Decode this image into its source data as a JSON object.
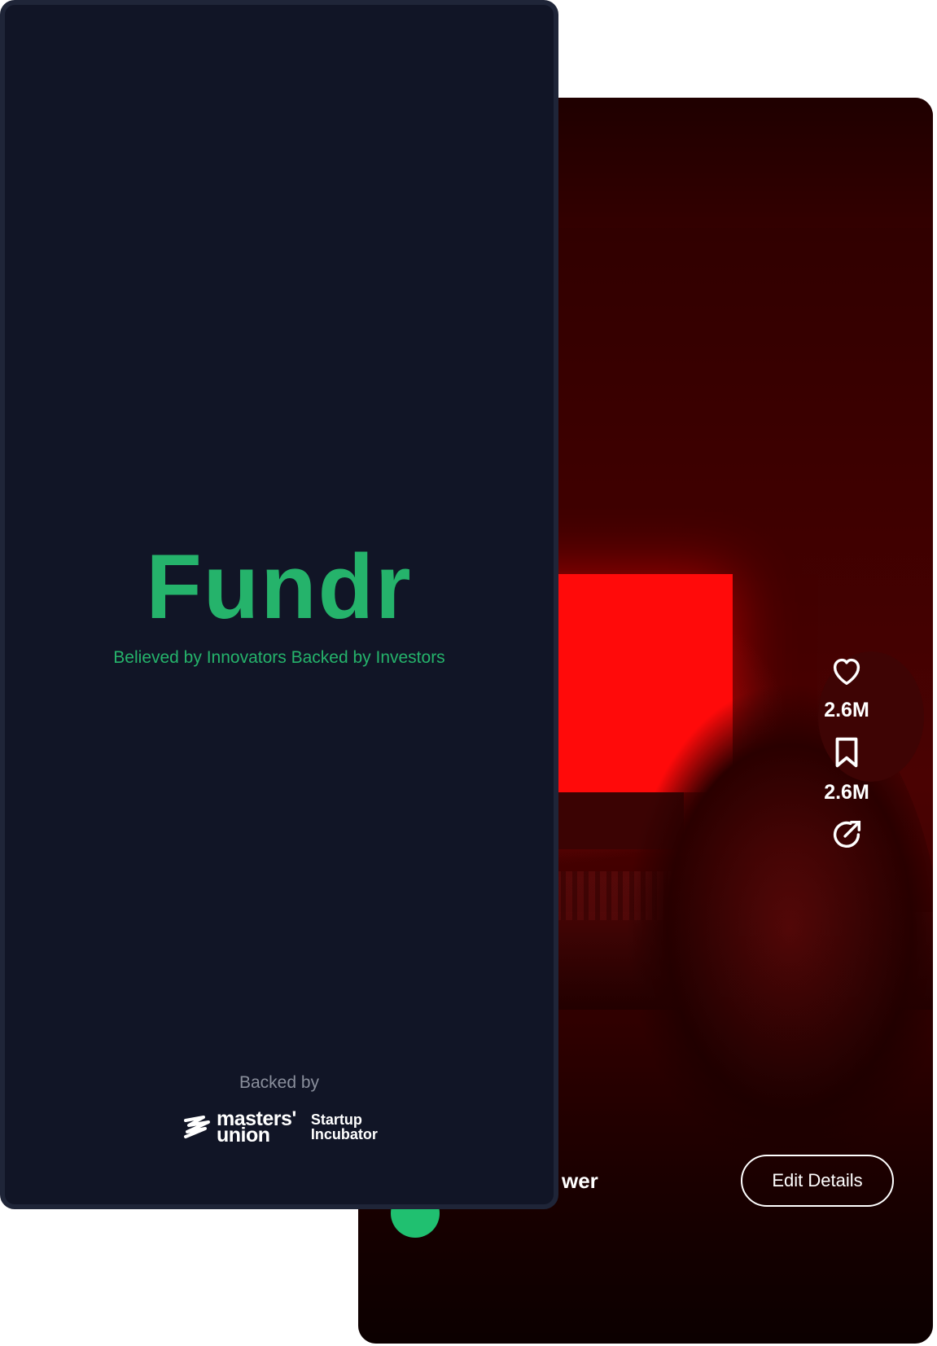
{
  "splash": {
    "brand": "Fundr",
    "tagline": "Believed by Innovators Backed by Investors",
    "backed_by": "Backed by",
    "sponsor": {
      "line1": "masters'",
      "line2": "union",
      "program1": "Startup",
      "program2": "Incubator"
    }
  },
  "feed": {
    "likes": "2.6M",
    "saves": "2.6M",
    "creator_partial": "wer",
    "edit_button": "Edit Details"
  },
  "colors": {
    "brand_green": "#25b36b",
    "splash_bg": "#111526",
    "feed_red": "#ff0a0a"
  }
}
